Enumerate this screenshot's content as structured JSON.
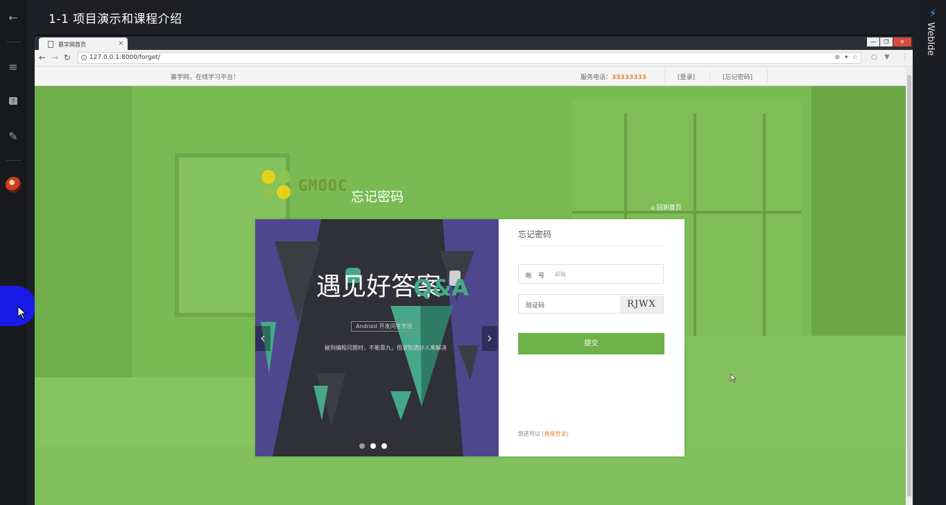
{
  "outer": {
    "title": "1-1 项目演示和课程介绍",
    "right_panel_label": "WebIde"
  },
  "browser": {
    "tab_title": "慕学网首页",
    "tab_close": "×",
    "url": "127.0.0.1:8000/forget/",
    "window_controls": {
      "minimize": "—",
      "restore": "❐",
      "close": "✕"
    }
  },
  "site_header": {
    "slogan": "慕学网，在线学习平台！",
    "phone_label": "服务电话：",
    "phone_number": "33333333",
    "login_link": "[登录]",
    "forgot_link": "[忘记密码]"
  },
  "brand": {
    "logo_text": "GMOOC",
    "page_title": "忘记密码",
    "back_home": "回到首页"
  },
  "banner": {
    "title": "遇见好答案",
    "qa": "Q&A",
    "subtitle": "Android 开发问答专场",
    "description": "碰到编程问题时，不能靠九，但求知遇好人来解决"
  },
  "form": {
    "title": "忘记密码",
    "account_label": "帐　号",
    "account_placeholder": "邮箱",
    "captcha_label": "验证码",
    "captcha_text": "RJWX",
    "submit_label": "提交",
    "footer_prefix": "您还可以",
    "footer_link": "[直接登录]"
  },
  "colors": {
    "page_green": "#79bb52",
    "button_green": "#6db34a",
    "accent_orange": "#e6893a",
    "banner_dark": "#2f3038",
    "banner_teal": "#46a889"
  }
}
